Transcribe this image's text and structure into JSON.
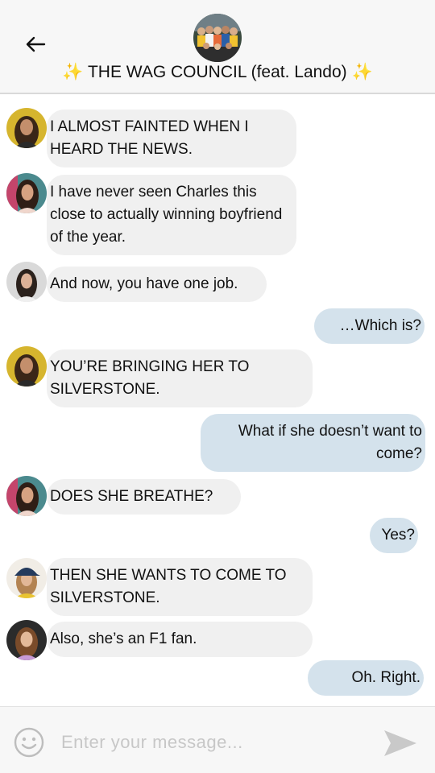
{
  "header": {
    "title": "✨ THE WAG COUNCIL (feat. Lando) ✨",
    "back_icon": "arrow-left-icon",
    "group_avatar": "group-photo"
  },
  "messages": [
    {
      "side": "in",
      "avatar": "yellow",
      "text": "I ALMOST FAINTED WHEN I HEARD THE NEWS."
    },
    {
      "side": "in",
      "avatar": "teal",
      "text": "I have never seen Charles this close to actually winning boyfriend of the year."
    },
    {
      "side": "in",
      "avatar": "gray",
      "text": "And now, you have one job."
    },
    {
      "side": "out",
      "text": "…Which is?"
    },
    {
      "side": "in",
      "avatar": "yellow",
      "text": "YOU’RE BRINGING HER TO SILVERSTONE."
    },
    {
      "side": "out",
      "text": "What if she doesn’t want to come?"
    },
    {
      "side": "in",
      "avatar": "teal",
      "text": "DOES SHE BREATHE?"
    },
    {
      "side": "out",
      "text": "Yes?"
    },
    {
      "side": "in",
      "avatar": "cap",
      "text": "THEN SHE WANTS TO COME TO SILVERSTONE."
    },
    {
      "side": "in",
      "avatar": "dark",
      "text": "Also, she’s an F1 fan."
    },
    {
      "side": "out",
      "text": "Oh. Right."
    }
  ],
  "composer": {
    "placeholder": "Enter your message...",
    "emoji_icon": "smiley-icon",
    "send_icon": "send-icon"
  },
  "colors": {
    "incoming_bubble": "#f0f0f0",
    "outgoing_bubble": "#d4e2ec",
    "header_bg": "#f7f7f7"
  }
}
